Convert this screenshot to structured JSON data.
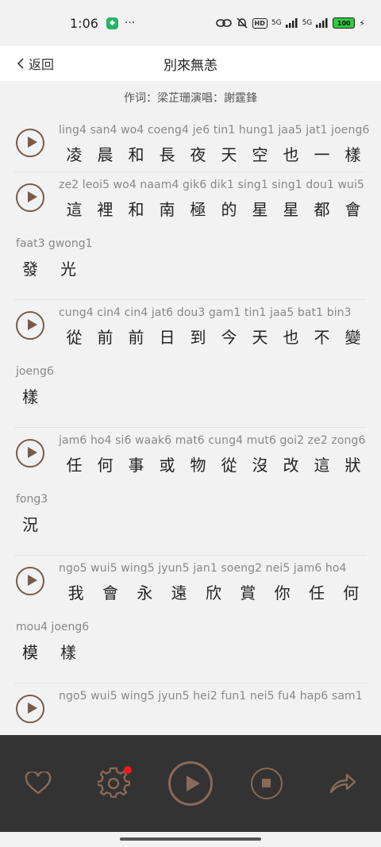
{
  "status": {
    "time": "1:06",
    "dots": "···",
    "hd": "HD",
    "net1": "5G",
    "net2": "5G",
    "battery": "100"
  },
  "nav": {
    "back_label": "返回",
    "title": "別來無恙"
  },
  "credits": "作词：梁芷珊演唱：謝霆鋒",
  "lines": [
    {
      "jyutping": "ling4 san4 wo4 coeng4 je6 tin1 hung1 jaa5 jat1 joeng6",
      "chars": [
        "凌",
        "晨",
        "和",
        "長",
        "夜",
        "天",
        "空",
        "也",
        "一",
        "樣"
      ]
    },
    {
      "jyutping": "ze2 leoi5 wo4 naam4 gik6 dik1 sing1 sing1 dou1 wui5",
      "chars": [
        "這",
        "裡",
        "和",
        "南",
        "極",
        "的",
        "星",
        "星",
        "都",
        "會"
      ],
      "cont_jyutping": "faat3 gwong1",
      "cont_chars": [
        "發",
        "光"
      ]
    },
    {
      "jyutping": "cung4 cin4 cin4 jat6 dou3 gam1 tin1 jaa5 bat1 bin3",
      "chars": [
        "從",
        "前",
        "前",
        "日",
        "到",
        "今",
        "天",
        "也",
        "不",
        "變"
      ],
      "cont_jyutping": "joeng6",
      "cont_chars": [
        "樣"
      ]
    },
    {
      "jyutping": "jam6 ho4 si6 waak6 mat6 cung4 mut6 goi2 ze2 zong6",
      "chars": [
        "任",
        "何",
        "事",
        "或",
        "物",
        "從",
        "沒",
        "改",
        "這",
        "狀"
      ],
      "cont_jyutping": "fong3",
      "cont_chars": [
        "況"
      ]
    },
    {
      "jyutping": "ngo5 wui5 wing5 jyun5 jan1 soeng2 nei5 jam6 ho4",
      "chars": [
        "我",
        "會",
        "永",
        "遠",
        "欣",
        "賞",
        "你",
        "任",
        "何"
      ],
      "cont_jyutping": "mou4 joeng6",
      "cont_chars": [
        "模",
        "樣"
      ]
    },
    {
      "jyutping": "ngo5 wui5 wing5 jyun5 hei2 fun1 nei5 fu4 hap6 sam1",
      "chars": []
    }
  ],
  "colors": {
    "accent": "#7a5a49",
    "bottom_bar": "#333333",
    "notification_dot": "#e81c1c"
  },
  "bottom_bar": {
    "icons": [
      "heart-icon",
      "settings-icon",
      "play-icon",
      "stop-icon",
      "share-icon"
    ]
  }
}
